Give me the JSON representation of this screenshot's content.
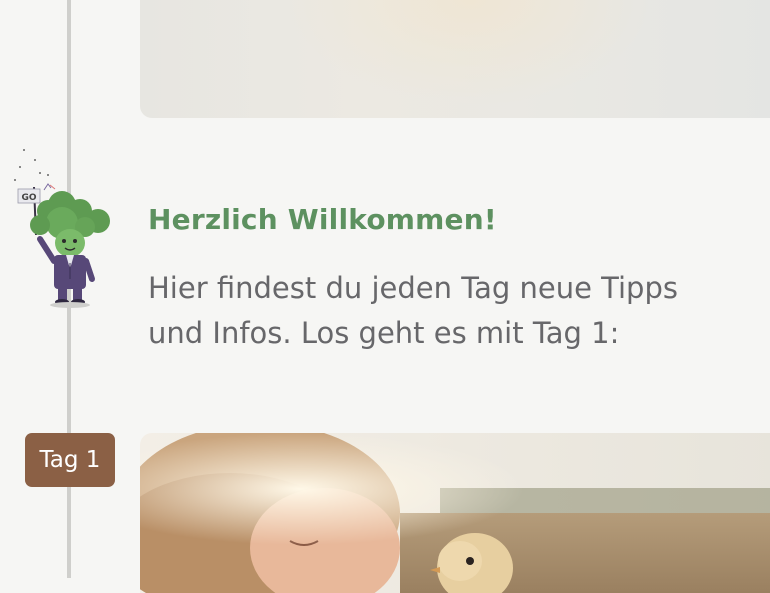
{
  "welcome": {
    "title": "Herzlich Willkommen!",
    "line1": "Hier findest du jeden Tag neue Tipps",
    "line2": "und Infos. Los geht es mit Tag 1:"
  },
  "mascot": {
    "flag_text": "GO"
  },
  "days": [
    {
      "label": "Tag 1"
    }
  ],
  "colors": {
    "title_green": "#5d9160",
    "badge_brown": "#8b6045",
    "text_gray": "#67676a",
    "background": "#f6f6f4"
  }
}
